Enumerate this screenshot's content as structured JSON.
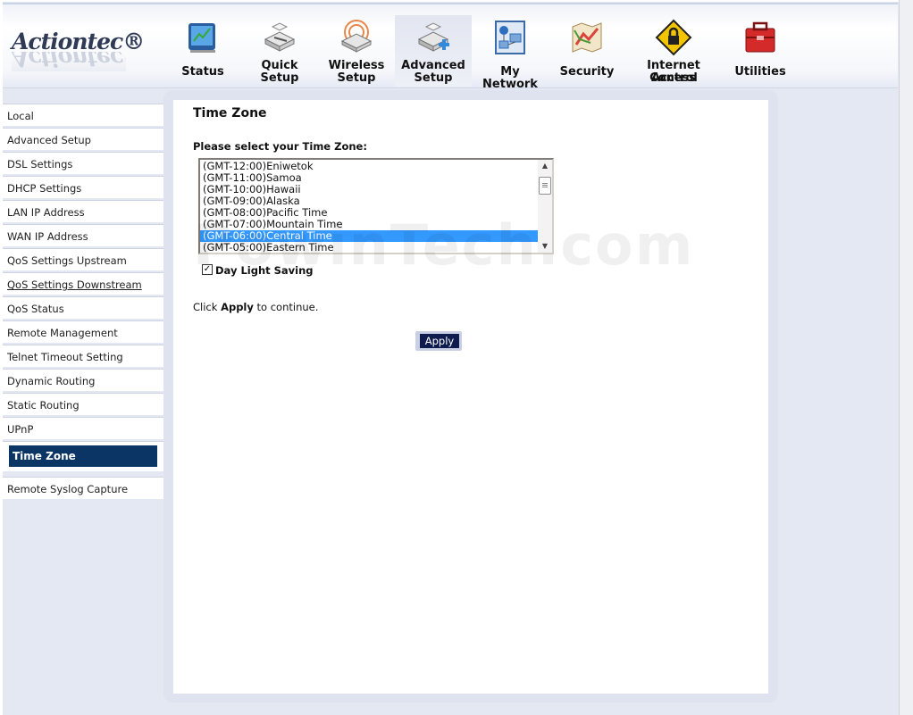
{
  "brand": {
    "logo_text": "Actiontec®"
  },
  "nav": [
    {
      "label_1": "Status",
      "label_2": "",
      "icon": "status-monitor-icon",
      "color": "#3a7bd5"
    },
    {
      "label_1": "Quick",
      "label_2": "Setup",
      "icon": "quick-setup-router-icon",
      "color": "#8a8a8a"
    },
    {
      "label_1": "Wireless",
      "label_2": "Setup",
      "icon": "wireless-router-icon",
      "color": "#e07a2e"
    },
    {
      "label_1": "Advanced",
      "label_2": "Setup",
      "icon": "advanced-setup-router-icon",
      "color": "#2e8be0"
    },
    {
      "label_1": "My Network",
      "label_2": "",
      "icon": "my-network-icon",
      "color": "#2c6fbf"
    },
    {
      "label_1": "Security",
      "label_2": "",
      "icon": "security-map-icon",
      "color": "#d9453b"
    },
    {
      "label_1": "Internet Access",
      "label_2": "Control",
      "icon": "lock-sign-icon",
      "color": "#f2c500"
    },
    {
      "label_1": "Utilities",
      "label_2": "",
      "icon": "toolbox-icon",
      "color": "#d42a2a"
    }
  ],
  "sidebar": {
    "items": [
      {
        "label": "Local"
      },
      {
        "label": "Advanced Setup"
      },
      {
        "label": "DSL Settings"
      },
      {
        "label": "DHCP Settings"
      },
      {
        "label": "LAN IP Address"
      },
      {
        "label": "WAN IP Address"
      },
      {
        "label": "QoS Settings Upstream"
      },
      {
        "label": "QoS Settings Downstream"
      },
      {
        "label": "QoS Status"
      },
      {
        "label": "Remote Management"
      },
      {
        "label": "Telnet Timeout Setting"
      },
      {
        "label": "Dynamic Routing"
      },
      {
        "label": "Static Routing"
      },
      {
        "label": "UPnP"
      },
      {
        "label": "Time Zone"
      },
      {
        "label": "Remote Syslog Capture"
      }
    ],
    "active_index": 14,
    "hovered_index": 7
  },
  "main": {
    "title": "Time Zone",
    "select_label": "Please select your Time Zone:",
    "timezones": [
      "(GMT-12:00)Eniwetok",
      "(GMT-11:00)Samoa",
      "(GMT-10:00)Hawaii",
      "(GMT-09:00)Alaska",
      "(GMT-08:00)Pacific Time",
      "(GMT-07:00)Mountain Time",
      "(GMT-06:00)Central Time",
      "(GMT-05:00)Eastern Time"
    ],
    "selected_timezone": "(GMT-06:00)Central Time",
    "daylight_saving_label": "Day Light Saving",
    "daylight_saving_checked": true,
    "hint_prefix": "Click ",
    "hint_bold": "Apply",
    "hint_suffix": " to continue.",
    "apply_label": "Apply"
  },
  "watermark": "PowinTech.com",
  "colors": {
    "active_sidebar": "#0a3565",
    "selected_option": "#3399ff",
    "apply_button": "#0d1b4e"
  }
}
